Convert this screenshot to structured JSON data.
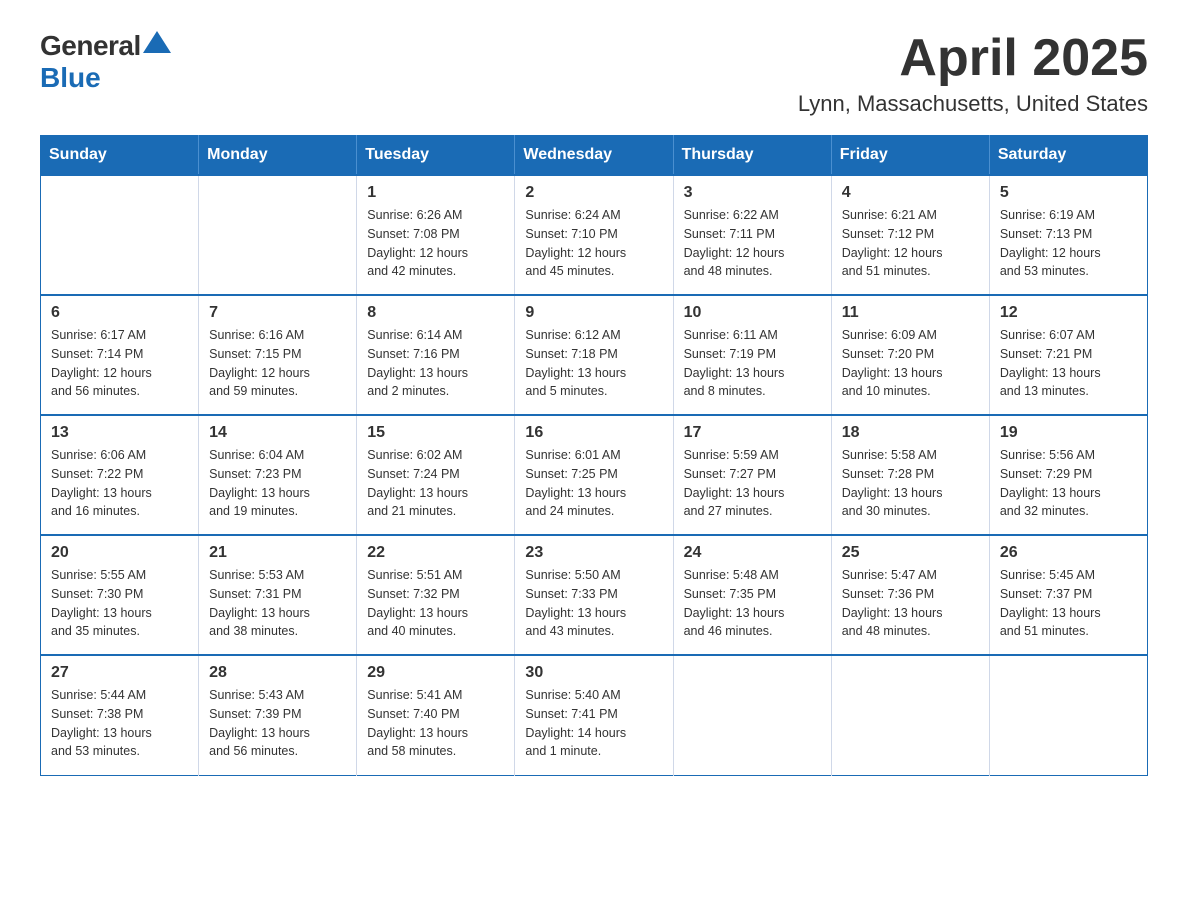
{
  "header": {
    "logo_general": "General",
    "logo_blue": "Blue",
    "title": "April 2025",
    "subtitle": "Lynn, Massachusetts, United States"
  },
  "days_header": [
    "Sunday",
    "Monday",
    "Tuesday",
    "Wednesday",
    "Thursday",
    "Friday",
    "Saturday"
  ],
  "weeks": [
    [
      {
        "day": "",
        "info": ""
      },
      {
        "day": "",
        "info": ""
      },
      {
        "day": "1",
        "info": "Sunrise: 6:26 AM\nSunset: 7:08 PM\nDaylight: 12 hours\nand 42 minutes."
      },
      {
        "day": "2",
        "info": "Sunrise: 6:24 AM\nSunset: 7:10 PM\nDaylight: 12 hours\nand 45 minutes."
      },
      {
        "day": "3",
        "info": "Sunrise: 6:22 AM\nSunset: 7:11 PM\nDaylight: 12 hours\nand 48 minutes."
      },
      {
        "day": "4",
        "info": "Sunrise: 6:21 AM\nSunset: 7:12 PM\nDaylight: 12 hours\nand 51 minutes."
      },
      {
        "day": "5",
        "info": "Sunrise: 6:19 AM\nSunset: 7:13 PM\nDaylight: 12 hours\nand 53 minutes."
      }
    ],
    [
      {
        "day": "6",
        "info": "Sunrise: 6:17 AM\nSunset: 7:14 PM\nDaylight: 12 hours\nand 56 minutes."
      },
      {
        "day": "7",
        "info": "Sunrise: 6:16 AM\nSunset: 7:15 PM\nDaylight: 12 hours\nand 59 minutes."
      },
      {
        "day": "8",
        "info": "Sunrise: 6:14 AM\nSunset: 7:16 PM\nDaylight: 13 hours\nand 2 minutes."
      },
      {
        "day": "9",
        "info": "Sunrise: 6:12 AM\nSunset: 7:18 PM\nDaylight: 13 hours\nand 5 minutes."
      },
      {
        "day": "10",
        "info": "Sunrise: 6:11 AM\nSunset: 7:19 PM\nDaylight: 13 hours\nand 8 minutes."
      },
      {
        "day": "11",
        "info": "Sunrise: 6:09 AM\nSunset: 7:20 PM\nDaylight: 13 hours\nand 10 minutes."
      },
      {
        "day": "12",
        "info": "Sunrise: 6:07 AM\nSunset: 7:21 PM\nDaylight: 13 hours\nand 13 minutes."
      }
    ],
    [
      {
        "day": "13",
        "info": "Sunrise: 6:06 AM\nSunset: 7:22 PM\nDaylight: 13 hours\nand 16 minutes."
      },
      {
        "day": "14",
        "info": "Sunrise: 6:04 AM\nSunset: 7:23 PM\nDaylight: 13 hours\nand 19 minutes."
      },
      {
        "day": "15",
        "info": "Sunrise: 6:02 AM\nSunset: 7:24 PM\nDaylight: 13 hours\nand 21 minutes."
      },
      {
        "day": "16",
        "info": "Sunrise: 6:01 AM\nSunset: 7:25 PM\nDaylight: 13 hours\nand 24 minutes."
      },
      {
        "day": "17",
        "info": "Sunrise: 5:59 AM\nSunset: 7:27 PM\nDaylight: 13 hours\nand 27 minutes."
      },
      {
        "day": "18",
        "info": "Sunrise: 5:58 AM\nSunset: 7:28 PM\nDaylight: 13 hours\nand 30 minutes."
      },
      {
        "day": "19",
        "info": "Sunrise: 5:56 AM\nSunset: 7:29 PM\nDaylight: 13 hours\nand 32 minutes."
      }
    ],
    [
      {
        "day": "20",
        "info": "Sunrise: 5:55 AM\nSunset: 7:30 PM\nDaylight: 13 hours\nand 35 minutes."
      },
      {
        "day": "21",
        "info": "Sunrise: 5:53 AM\nSunset: 7:31 PM\nDaylight: 13 hours\nand 38 minutes."
      },
      {
        "day": "22",
        "info": "Sunrise: 5:51 AM\nSunset: 7:32 PM\nDaylight: 13 hours\nand 40 minutes."
      },
      {
        "day": "23",
        "info": "Sunrise: 5:50 AM\nSunset: 7:33 PM\nDaylight: 13 hours\nand 43 minutes."
      },
      {
        "day": "24",
        "info": "Sunrise: 5:48 AM\nSunset: 7:35 PM\nDaylight: 13 hours\nand 46 minutes."
      },
      {
        "day": "25",
        "info": "Sunrise: 5:47 AM\nSunset: 7:36 PM\nDaylight: 13 hours\nand 48 minutes."
      },
      {
        "day": "26",
        "info": "Sunrise: 5:45 AM\nSunset: 7:37 PM\nDaylight: 13 hours\nand 51 minutes."
      }
    ],
    [
      {
        "day": "27",
        "info": "Sunrise: 5:44 AM\nSunset: 7:38 PM\nDaylight: 13 hours\nand 53 minutes."
      },
      {
        "day": "28",
        "info": "Sunrise: 5:43 AM\nSunset: 7:39 PM\nDaylight: 13 hours\nand 56 minutes."
      },
      {
        "day": "29",
        "info": "Sunrise: 5:41 AM\nSunset: 7:40 PM\nDaylight: 13 hours\nand 58 minutes."
      },
      {
        "day": "30",
        "info": "Sunrise: 5:40 AM\nSunset: 7:41 PM\nDaylight: 14 hours\nand 1 minute."
      },
      {
        "day": "",
        "info": ""
      },
      {
        "day": "",
        "info": ""
      },
      {
        "day": "",
        "info": ""
      }
    ]
  ]
}
